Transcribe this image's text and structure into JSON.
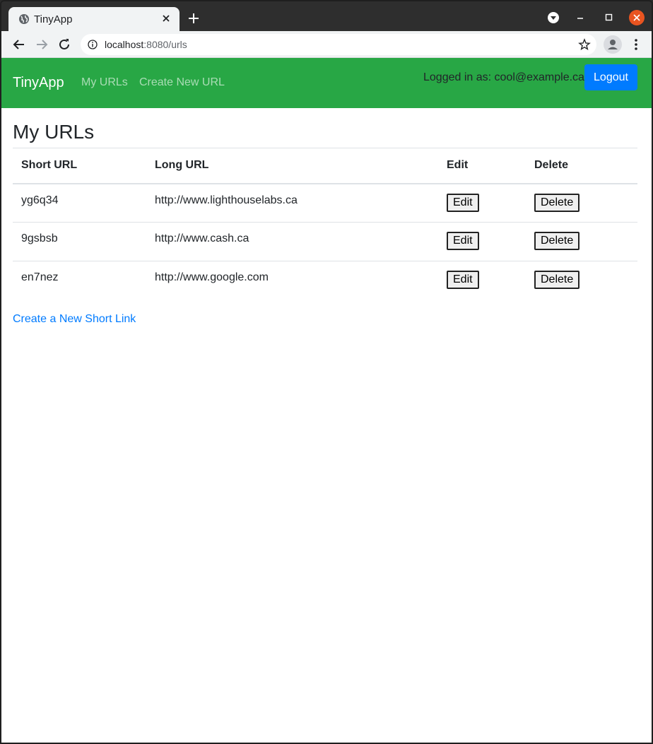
{
  "browser": {
    "tab_title": "TinyApp",
    "url_host": "localhost",
    "url_path": ":8080/urls"
  },
  "icons": {
    "favicon": "globe-icon",
    "tab_close": "close-icon",
    "new_tab": "plus-icon",
    "back": "arrow-left-icon",
    "forward": "arrow-right-icon",
    "reload": "reload-icon",
    "info": "info-icon",
    "bookmark": "star-icon",
    "profile": "account-icon",
    "menu": "kebab-menu-icon"
  },
  "colors": {
    "navbar": "#28a745",
    "primary": "#007bff",
    "window_close": "#e95420"
  },
  "navbar": {
    "brand": "TinyApp",
    "links": [
      "My URLs",
      "Create New URL"
    ],
    "logged_in_text": "Logged in as: cool@example.ca",
    "logout_label": "Logout"
  },
  "main": {
    "title": "My URLs",
    "table": {
      "headers": [
        "Short URL",
        "Long URL",
        "Edit",
        "Delete"
      ],
      "rows": [
        {
          "short": "yg6q34",
          "long": "http://www.lighthouselabs.ca",
          "edit": "Edit",
          "delete": "Delete"
        },
        {
          "short": "9gsbsb",
          "long": "http://www.cash.ca",
          "edit": "Edit",
          "delete": "Delete"
        },
        {
          "short": "en7nez",
          "long": "http://www.google.com",
          "edit": "Edit",
          "delete": "Delete"
        }
      ]
    },
    "create_link": "Create a New Short Link"
  }
}
